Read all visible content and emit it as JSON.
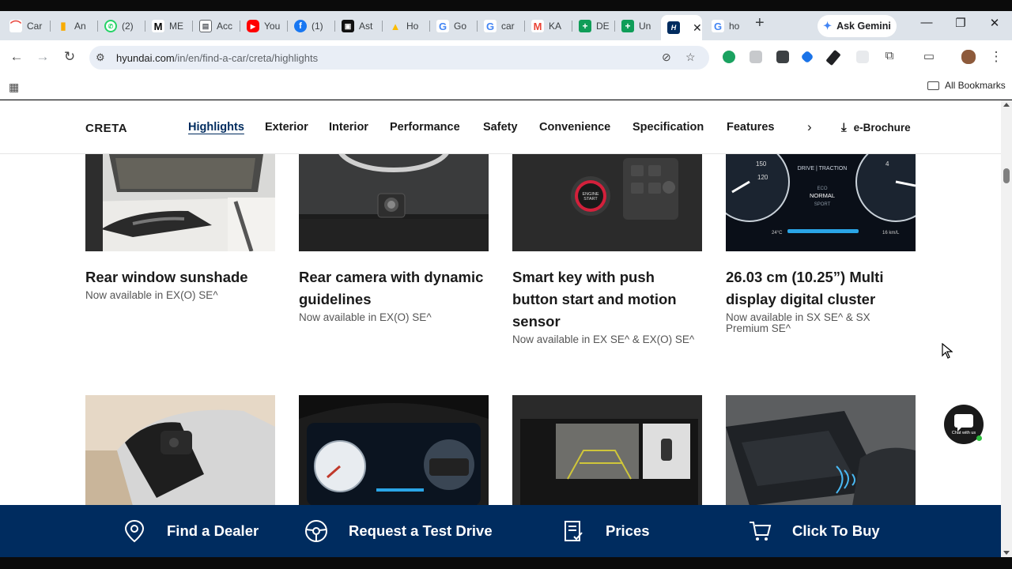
{
  "tabs": [
    {
      "label": "Car",
      "favicon": "car-icon",
      "color": "#e8453c"
    },
    {
      "label": "An",
      "favicon": "analytics-icon",
      "color": "#f9ab00"
    },
    {
      "label": "(2)",
      "favicon": "whatsapp-icon",
      "color": "#25d366"
    },
    {
      "label": "ME",
      "favicon": "m-icon",
      "color": "#000000"
    },
    {
      "label": "Acc",
      "favicon": "acc-icon",
      "color": "#5f6368"
    },
    {
      "label": "You",
      "favicon": "youtube-icon",
      "color": "#ff0000"
    },
    {
      "label": "(1)",
      "favicon": "facebook-icon",
      "color": "#1877f2"
    },
    {
      "label": "Ast",
      "favicon": "ast-icon",
      "color": "#111111"
    },
    {
      "label": "Ho",
      "favicon": "drive-icon",
      "color": "#fbbc04"
    },
    {
      "label": "Go",
      "favicon": "google-icon",
      "color": "#4285f4"
    },
    {
      "label": "car",
      "favicon": "google-icon",
      "color": "#4285f4"
    },
    {
      "label": "KA",
      "favicon": "gmail-icon",
      "color": "#ea4335"
    },
    {
      "label": "DE",
      "favicon": "sheets-icon",
      "color": "#0f9d58"
    },
    {
      "label": "Un",
      "favicon": "sheets-icon",
      "color": "#0f9d58"
    },
    {
      "label": "",
      "favicon": "hyundai-icon",
      "color": "#002c5f",
      "active": true
    },
    {
      "label": "ho",
      "favicon": "google-icon",
      "color": "#4285f4"
    }
  ],
  "browser": {
    "gemini_label": "Ask Gemini",
    "url_host": "hyundai.com",
    "url_path": "/in/en/find-a-car/creta/highlights",
    "all_bookmarks": "All Bookmarks"
  },
  "subnav": {
    "model": "CRETA",
    "links": [
      "Highlights",
      "Exterior",
      "Interior",
      "Performance",
      "Safety",
      "Convenience",
      "Specification",
      "Features"
    ],
    "active": "Highlights",
    "brochure": "e-Brochure"
  },
  "features": [
    {
      "title": "Rear window sunshade",
      "subtitle": "Now available in EX(O) SE^"
    },
    {
      "title": "Rear camera with dynamic guidelines",
      "subtitle": "Now available in EX(O) SE^"
    },
    {
      "title": "Smart key with push button start and motion sensor",
      "subtitle": "Now available in EX SE^ & EX(O) SE^"
    },
    {
      "title": "26.03 cm (10.25”) Multi display digital cluster",
      "subtitle": "Now available in SX SE^ & SX Premium SE^"
    }
  ],
  "cluster_text": {
    "drive_mode": "DRIVE | TRACTION",
    "eco": "ECO",
    "normal": "NORMAL",
    "sport": "SPORT",
    "temp": "24°C",
    "range": "16 km/L"
  },
  "cta": [
    {
      "label": "Find a Dealer",
      "icon": "location-pin-icon"
    },
    {
      "label": "Request a Test Drive",
      "icon": "steering-wheel-icon"
    },
    {
      "label": "Prices",
      "icon": "price-list-icon"
    },
    {
      "label": "Click To Buy",
      "icon": "cart-icon"
    }
  ],
  "chat": {
    "label": "Chat with us"
  }
}
